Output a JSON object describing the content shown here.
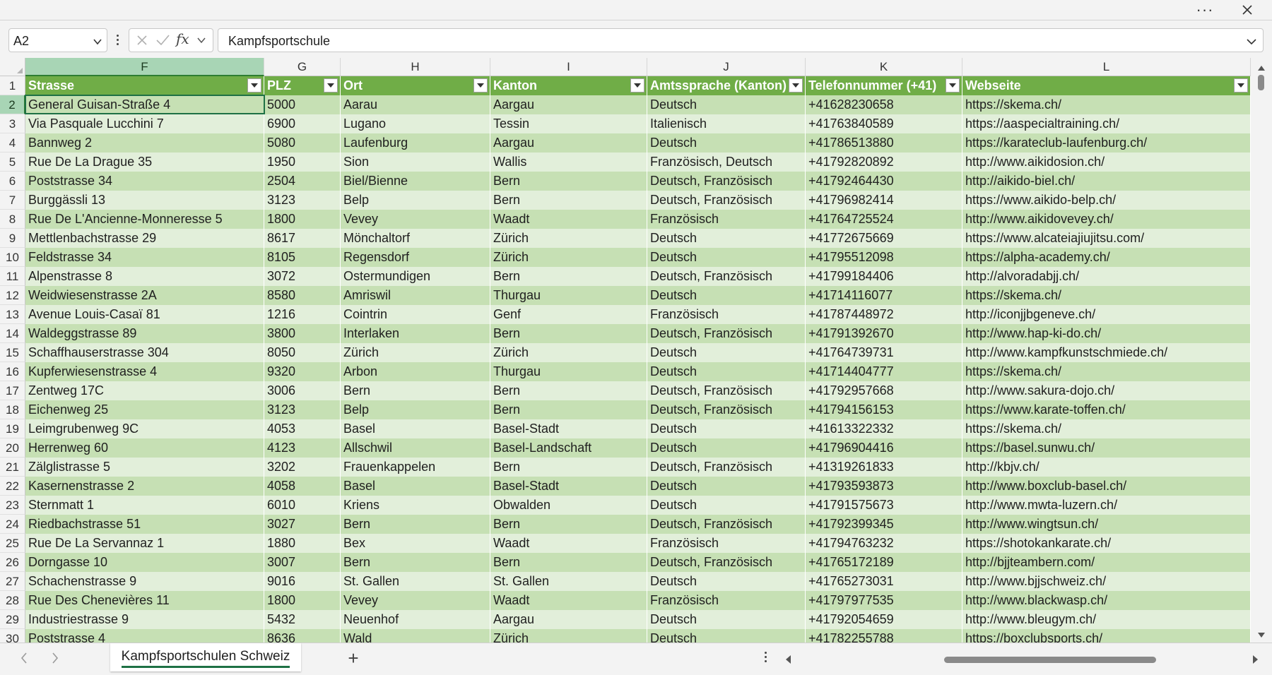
{
  "name_box": "A2",
  "formula_value": "Kampfsportschule",
  "fx_label": "fx",
  "columns": [
    {
      "letter": "F"
    },
    {
      "letter": "G"
    },
    {
      "letter": "H"
    },
    {
      "letter": "I"
    },
    {
      "letter": "J"
    },
    {
      "letter": "K"
    },
    {
      "letter": "L"
    }
  ],
  "selected_column": "F",
  "selected_row": "2",
  "table_headers": [
    "Strasse",
    "PLZ",
    "Ort",
    "Kanton",
    "Amtssprache (Kanton)",
    "Telefonnummer (+41)",
    "Webseite"
  ],
  "rows": [
    {
      "num": "2",
      "cells": [
        "General Guisan-Straße 4",
        "5000",
        "Aarau",
        "Aargau",
        "Deutsch",
        "+41628230658",
        "https://skema.ch/"
      ]
    },
    {
      "num": "3",
      "cells": [
        "Via Pasquale Lucchini 7",
        "6900",
        "Lugano",
        "Tessin",
        "Italienisch",
        "+41763840589",
        "https://aaspecialtraining.ch/"
      ]
    },
    {
      "num": "4",
      "cells": [
        "Bannweg 2",
        "5080",
        "Laufenburg",
        "Aargau",
        "Deutsch",
        "+41786513880",
        "https://karateclub-laufenburg.ch/"
      ]
    },
    {
      "num": "5",
      "cells": [
        "Rue De La Drague 35",
        "1950",
        "Sion",
        "Wallis",
        "Französisch, Deutsch",
        "+41792820892",
        "http://www.aikidosion.ch/"
      ]
    },
    {
      "num": "6",
      "cells": [
        "Poststrasse 34",
        "2504",
        "Biel/Bienne",
        "Bern",
        "Deutsch, Französisch",
        "+41792464430",
        "http://aikido-biel.ch/"
      ]
    },
    {
      "num": "7",
      "cells": [
        "Burggässli 13",
        "3123",
        "Belp",
        "Bern",
        "Deutsch, Französisch",
        "+41796982414",
        "https://www.aikido-belp.ch/"
      ]
    },
    {
      "num": "8",
      "cells": [
        "Rue De L'Ancienne-Monneresse 5",
        "1800",
        "Vevey",
        "Waadt",
        "Französisch",
        "+41764725524",
        "http://www.aikidovevey.ch/"
      ]
    },
    {
      "num": "9",
      "cells": [
        "Mettlenbachstrasse 29",
        "8617",
        "Mönchaltorf",
        "Zürich",
        "Deutsch",
        "+41772675669",
        "https://www.alcateiajiujitsu.com/"
      ]
    },
    {
      "num": "10",
      "cells": [
        "Feldstrasse 34",
        "8105",
        "Regensdorf",
        "Zürich",
        "Deutsch",
        "+41795512098",
        "https://alpha-academy.ch/"
      ]
    },
    {
      "num": "11",
      "cells": [
        "Alpenstrasse 8",
        "3072",
        "Ostermundigen",
        "Bern",
        "Deutsch, Französisch",
        "+41799184406",
        "http://alvoradabjj.ch/"
      ]
    },
    {
      "num": "12",
      "cells": [
        "Weidwiesenstrasse 2A",
        "8580",
        "Amriswil",
        "Thurgau",
        "Deutsch",
        "+41714116077",
        "https://skema.ch/"
      ]
    },
    {
      "num": "13",
      "cells": [
        "Avenue Louis-Casaï 81",
        "1216",
        "Cointrin",
        "Genf",
        "Französisch",
        "+41787448972",
        "http://iconjjbgeneve.ch/"
      ]
    },
    {
      "num": "14",
      "cells": [
        "Waldeggstrasse 89",
        "3800",
        "Interlaken",
        "Bern",
        "Deutsch, Französisch",
        "+41791392670",
        "http://www.hap-ki-do.ch/"
      ]
    },
    {
      "num": "15",
      "cells": [
        "Schaffhauserstrasse 304",
        "8050",
        "Zürich",
        "Zürich",
        "Deutsch",
        "+41764739731",
        "http://www.kampfkunstschmiede.ch/"
      ]
    },
    {
      "num": "16",
      "cells": [
        "Kupferwiesenstrasse 4",
        "9320",
        "Arbon",
        "Thurgau",
        "Deutsch",
        "+41714404777",
        "https://skema.ch/"
      ]
    },
    {
      "num": "17",
      "cells": [
        "Zentweg 17C",
        "3006",
        "Bern",
        "Bern",
        "Deutsch, Französisch",
        "+41792957668",
        "http://www.sakura-dojo.ch/"
      ]
    },
    {
      "num": "18",
      "cells": [
        "Eichenweg 25",
        "3123",
        "Belp",
        "Bern",
        "Deutsch, Französisch",
        "+41794156153",
        "https://www.karate-toffen.ch/"
      ]
    },
    {
      "num": "19",
      "cells": [
        "Leimgrubenweg 9C",
        "4053",
        "Basel",
        "Basel-Stadt",
        "Deutsch",
        "+41613322332",
        "https://skema.ch/"
      ]
    },
    {
      "num": "20",
      "cells": [
        "Herrenweg 60",
        "4123",
        "Allschwil",
        "Basel-Landschaft",
        "Deutsch",
        "+41796904416",
        "https://basel.sunwu.ch/"
      ]
    },
    {
      "num": "21",
      "cells": [
        "Zälglistrasse 5",
        "3202",
        "Frauenkappelen",
        "Bern",
        "Deutsch, Französisch",
        "+41319261833",
        "http://kbjv.ch/"
      ]
    },
    {
      "num": "22",
      "cells": [
        "Kasernenstrasse 2",
        "4058",
        "Basel",
        "Basel-Stadt",
        "Deutsch",
        "+41793593873",
        "http://www.boxclub-basel.ch/"
      ]
    },
    {
      "num": "23",
      "cells": [
        "Sternmatt 1",
        "6010",
        "Kriens",
        "Obwalden",
        "Deutsch",
        "+41791575673",
        "http://www.mwta-luzern.ch/"
      ]
    },
    {
      "num": "24",
      "cells": [
        "Riedbachstrasse 51",
        "3027",
        "Bern",
        "Bern",
        "Deutsch, Französisch",
        "+41792399345",
        "http://www.wingtsun.ch/"
      ]
    },
    {
      "num": "25",
      "cells": [
        "Rue De La Servannaz 1",
        "1880",
        "Bex",
        "Waadt",
        "Französisch",
        "+41794763232",
        "https://shotokankarate.ch/"
      ]
    },
    {
      "num": "26",
      "cells": [
        "Dorngasse 10",
        "3007",
        "Bern",
        "Bern",
        "Deutsch, Französisch",
        "+41765172189",
        "http://bjjteambern.com/"
      ]
    },
    {
      "num": "27",
      "cells": [
        "Schachenstrasse 9",
        "9016",
        "St. Gallen",
        "St. Gallen",
        "Deutsch",
        "+41765273031",
        "http://www.bjjschweiz.ch/"
      ]
    },
    {
      "num": "28",
      "cells": [
        "Rue Des Chenevières 11",
        "1800",
        "Vevey",
        "Waadt",
        "Französisch",
        "+41797977535",
        "http://www.blackwasp.ch/"
      ]
    },
    {
      "num": "29",
      "cells": [
        "Industriestrasse 9",
        "5432",
        "Neuenhof",
        "Aargau",
        "Deutsch",
        "+41792054659",
        "http://www.bleugym.ch/"
      ]
    },
    {
      "num": "30",
      "cells": [
        "Poststrasse 4",
        "8636",
        "Wald",
        "Zürich",
        "Deutsch",
        "+41782255788",
        "https://boxclubsports.ch/"
      ]
    }
  ],
  "sheet_tab": "Kampfsportschulen Schweiz",
  "colors": {
    "table_header": "#70ad47",
    "band_dark": "#c6e0b4",
    "band_light": "#e2efda",
    "selection": "#1e7145"
  }
}
